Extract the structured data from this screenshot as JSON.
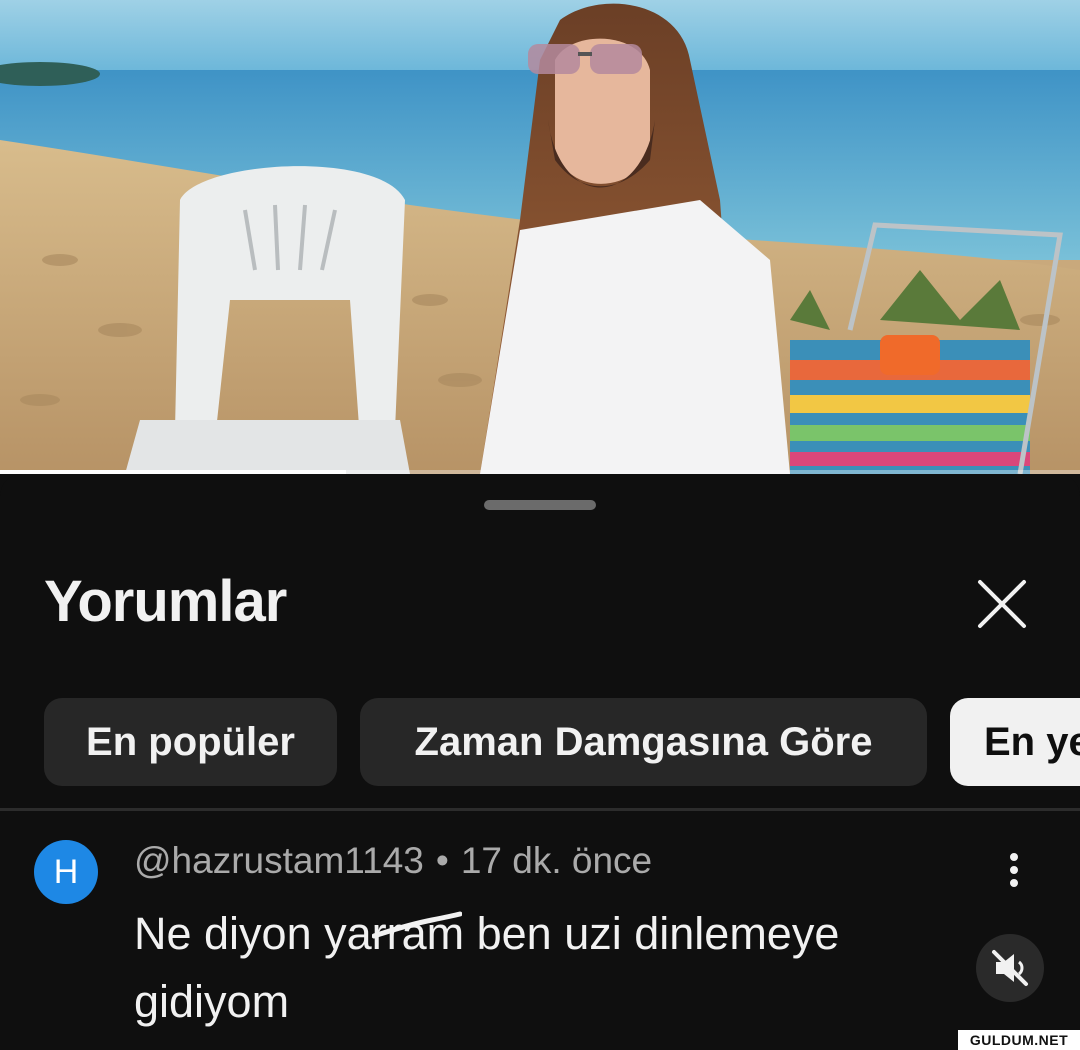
{
  "video": {
    "thumbnail_icon": "video-frame",
    "progress_fraction": 0.32
  },
  "comments_panel": {
    "title": "Yorumlar",
    "close_icon": "close-icon",
    "filters": [
      {
        "label": "En popüler",
        "selected": false
      },
      {
        "label": "Zaman Damgasına Göre",
        "selected": false
      },
      {
        "label": "En yeni",
        "selected": true
      }
    ]
  },
  "comment": {
    "avatar_letter": "H",
    "avatar_color": "#1e88e5",
    "author": "@hazrustam1143",
    "separator": "•",
    "time": "17 dk. önce",
    "text_before": "Ne diyon ",
    "text_censored": "yarram",
    "text_after": " ben uzi dinlemeye gidiyom",
    "more_icon": "more-vertical-icon",
    "mute_icon": "volume-mute-icon"
  },
  "watermark": "GULDUM.NET",
  "colors": {
    "background": "#0f0f0f",
    "chip": "#272727",
    "chip_active": "#f1f1f1",
    "meta_text": "#aaaaaa"
  }
}
